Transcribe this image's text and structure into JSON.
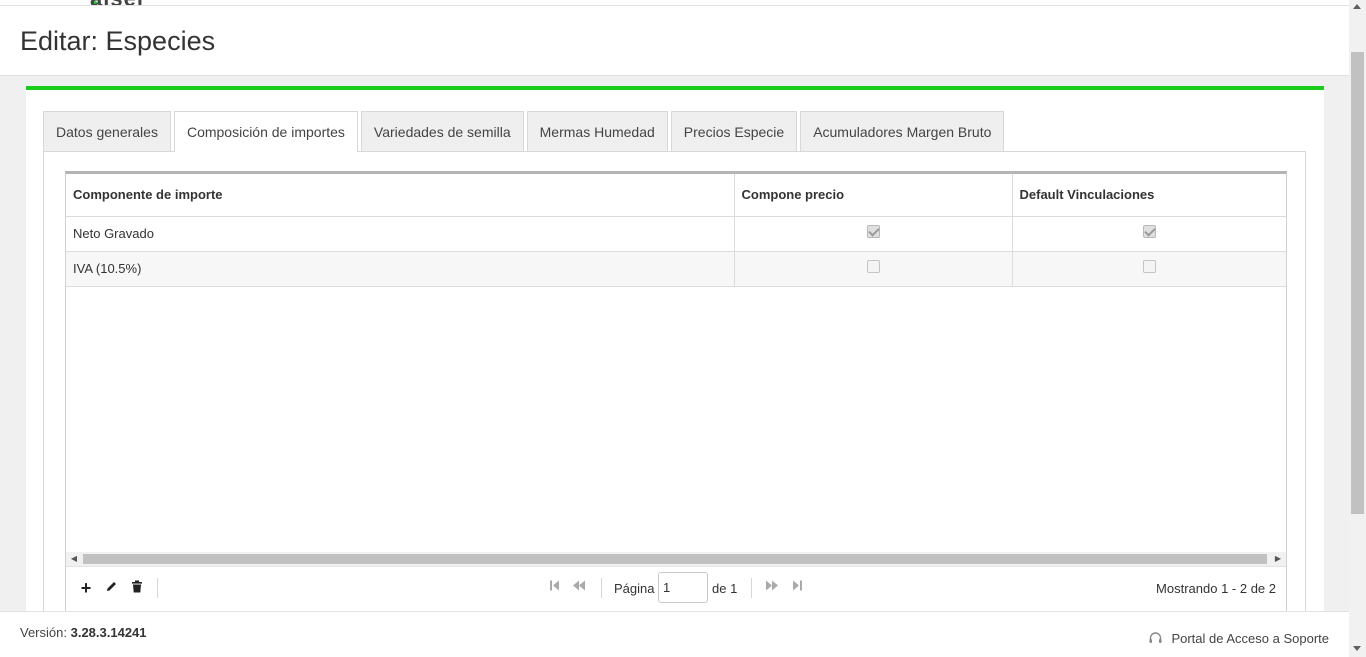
{
  "logo": {
    "text": "alser"
  },
  "header": {
    "title": "Editar: Especies"
  },
  "tabs": [
    {
      "label": "Datos generales",
      "active": false
    },
    {
      "label": "Composición de importes",
      "active": true
    },
    {
      "label": "Variedades de semilla",
      "active": false
    },
    {
      "label": "Mermas Humedad",
      "active": false
    },
    {
      "label": "Precios Especie",
      "active": false
    },
    {
      "label": "Acumuladores Margen Bruto",
      "active": false
    }
  ],
  "grid": {
    "columns": [
      "Componente de importe",
      "Compone precio",
      "Default Vinculaciones"
    ],
    "rows": [
      {
        "componente": "Neto Gravado",
        "compone_precio": true,
        "default_vinculaciones": true
      },
      {
        "componente": "IVA (10.5%)",
        "compone_precio": false,
        "default_vinculaciones": false
      }
    ]
  },
  "pager": {
    "page_label": "Página",
    "page_value": "1",
    "of_label": "de 1",
    "showing": "Mostrando 1 - 2 de 2"
  },
  "footer": {
    "version_label": "Versión:",
    "version_value": "3.28.3.14241",
    "support_link": "Portal de Acceso a Soporte"
  },
  "colors": {
    "accent": "#1ccc1c"
  }
}
